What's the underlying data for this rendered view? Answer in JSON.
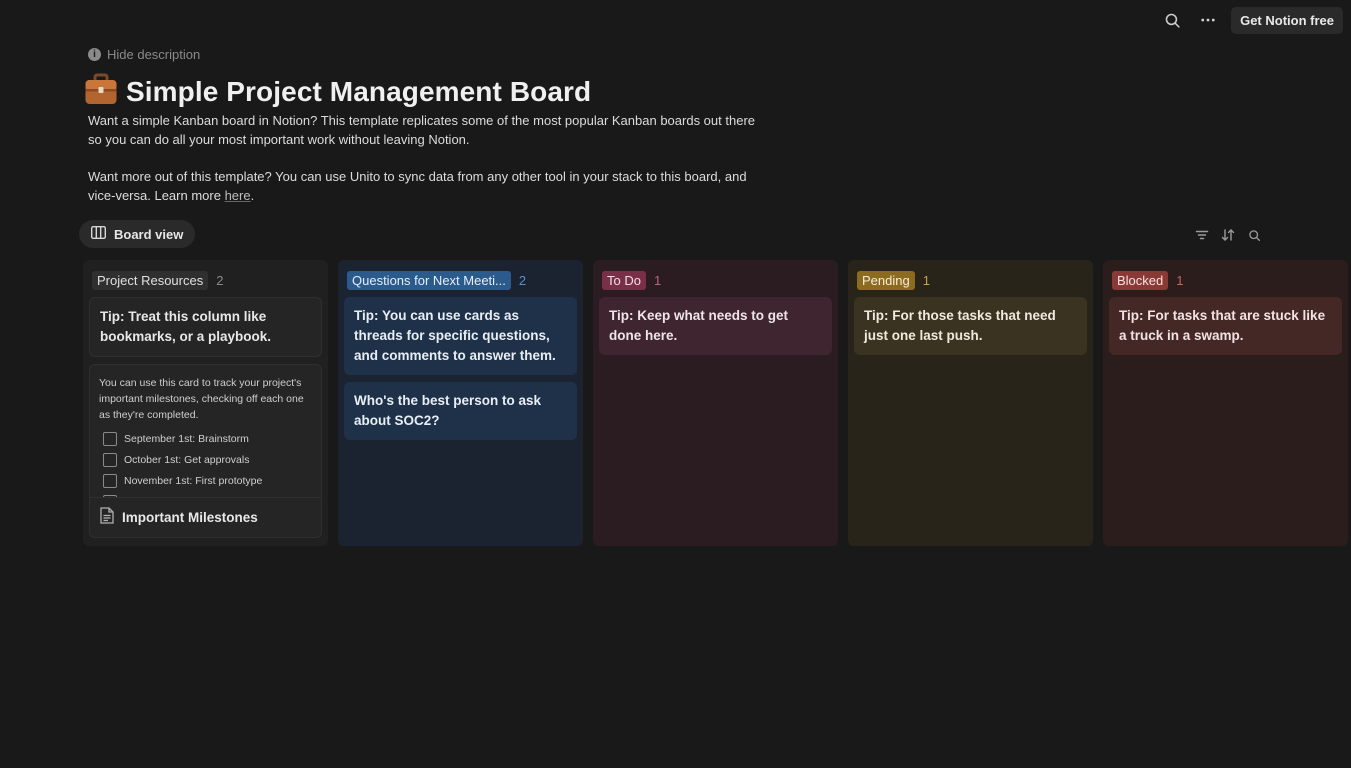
{
  "topbar": {
    "search_icon": "search-icon",
    "more_icon": "more-horizontal-icon",
    "cta_label": "Get Notion free"
  },
  "description_toggle": {
    "label": "Hide description",
    "icon": "info-icon"
  },
  "page": {
    "icon": "briefcase-icon",
    "icon_glyph": "💼",
    "title": "Simple Project Management Board",
    "paragraph_1": "Want a simple Kanban board in Notion? This template replicates some of the most popular Kanban boards out there so you can do all your most important work without leaving Notion.",
    "paragraph_2_prefix": "Want more out of this template? You can use Unito to sync data from any other tool in your stack to this board, and vice-versa. Learn more ",
    "paragraph_2_link": "here",
    "paragraph_2_suffix": "."
  },
  "view": {
    "label": "Board view",
    "icon": "board-view-icon",
    "tools": [
      "filter-icon",
      "sort-icon",
      "search-icon"
    ]
  },
  "columns": [
    {
      "name": "Project Resources",
      "count": "2",
      "color": "#2f2f2f",
      "cards": [
        {
          "title": "Tip: Treat this column like bookmarks, or a playbook."
        }
      ],
      "page_card": {
        "preview_intro": "You can use this card to track your project's important milestones, checking off each one as they're completed.",
        "todos": [
          "September 1st: Brainstorm",
          "October 1st: Get approvals",
          "November 1st: First prototype"
        ],
        "title": "Important Milestones",
        "icon": "page-icon"
      }
    },
    {
      "name": "Questions for Next Meeti...",
      "count": "2",
      "color": "#2b5a8c",
      "cards": [
        {
          "title": "Tip: You can use cards as threads for specific questions, and comments to answer them."
        },
        {
          "title": "Who's the best person to ask about SOC2?"
        }
      ]
    },
    {
      "name": "To Do",
      "count": "1",
      "color": "#7a2f48",
      "cards": [
        {
          "title": "Tip: Keep what needs to get done here."
        }
      ]
    },
    {
      "name": "Pending",
      "count": "1",
      "color": "#8c6a1f",
      "cards": [
        {
          "title": "Tip: For those tasks that need just one last push."
        }
      ]
    },
    {
      "name": "Blocked",
      "count": "1",
      "color": "#8a3a36",
      "cards": [
        {
          "title": "Tip: For tasks that are stuck like a truck in a swamp."
        }
      ]
    }
  ]
}
